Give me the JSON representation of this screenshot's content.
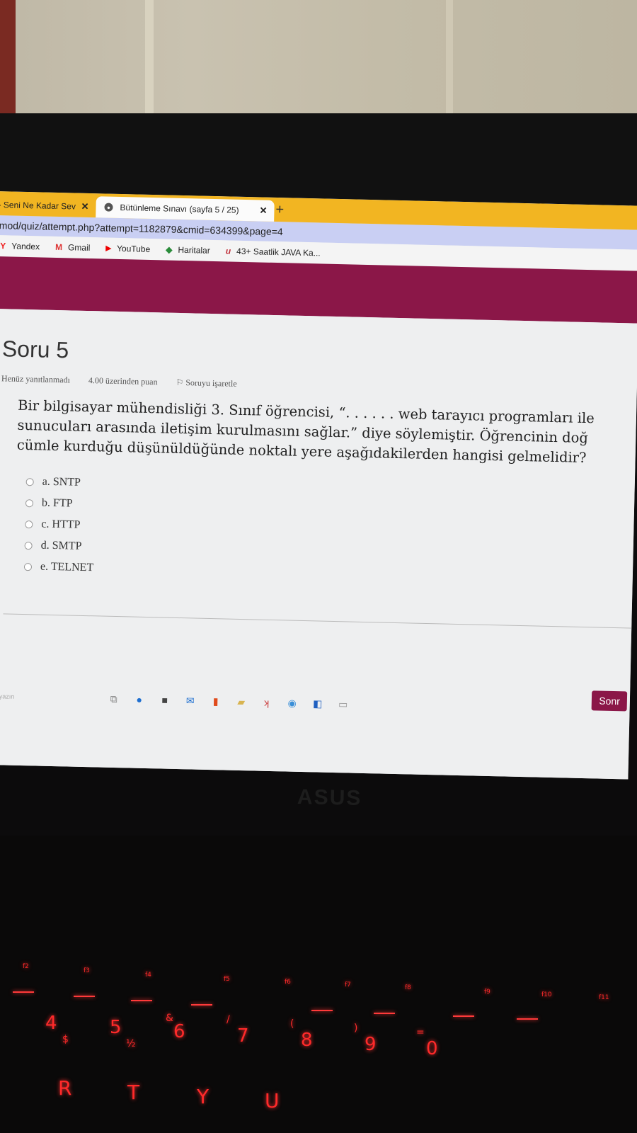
{
  "browser": {
    "tabs": [
      {
        "label": "- Seni Ne Kadar Sev",
        "active": false
      },
      {
        "label": "Bütünleme Sınavı (sayfa 5 / 25)",
        "active": true
      }
    ],
    "close_glyph": "✕",
    "new_tab_glyph": "+",
    "address": "/mod/quiz/attempt.php?attempt=1182879&cmid=634399&page=4",
    "bookmarks": [
      {
        "label": "Yandex",
        "icon": "yandex-icon",
        "glyph": "Y"
      },
      {
        "label": "Gmail",
        "icon": "gmail-icon",
        "glyph": "M"
      },
      {
        "label": "YouTube",
        "icon": "youtube-icon",
        "glyph": "▶"
      },
      {
        "label": "Haritalar",
        "icon": "maps-icon",
        "glyph": "◆"
      },
      {
        "label": "43+ Saatlik JAVA Ka...",
        "icon": "udemy-icon",
        "glyph": "u"
      }
    ]
  },
  "quiz": {
    "title": "Soru 5",
    "status": "Henüz yanıtlanmadı",
    "points": "4.00 üzerinden puan",
    "flag": "Soruyu işaretle",
    "question_lines": [
      "Bir bilgisayar mühendisliği 3. Sınıf öğrencisi, “. . . . . . web tarayıcı programları ile",
      "sunucuları arasında iletişim kurulmasını sağlar.” diye söylemiştir. Öğrencinin doğ",
      "cümle kurduğu düşünüldüğünde noktalı yere aşağıdakilerden hangisi gelmelidir?"
    ],
    "answers": [
      "a. SNTP",
      "b. FTP",
      "c. HTTP",
      "d. SMTP",
      "e. TELNET"
    ],
    "next_button": "Sonr"
  },
  "taskbar": {
    "search_hint": "aya yazın"
  },
  "colors": {
    "tabstrip": "#f2b522",
    "banner": "#8b1748",
    "address_bg": "#c9cff3",
    "key_backlight": "#ff2a2a"
  },
  "keyboard": {
    "fkeys": [
      "f2",
      "f3",
      "f4",
      "f5",
      "f6",
      "f7",
      "f8",
      "f9",
      "f10",
      "f11"
    ],
    "numkeys": [
      "4",
      "5",
      "6",
      "7",
      "8",
      "9",
      "0"
    ],
    "numsub": [
      "$",
      "½",
      "&",
      "/",
      "(",
      ")",
      "="
    ],
    "letters": [
      "R",
      "T",
      "Y",
      "U"
    ]
  },
  "brand": "ASUS"
}
